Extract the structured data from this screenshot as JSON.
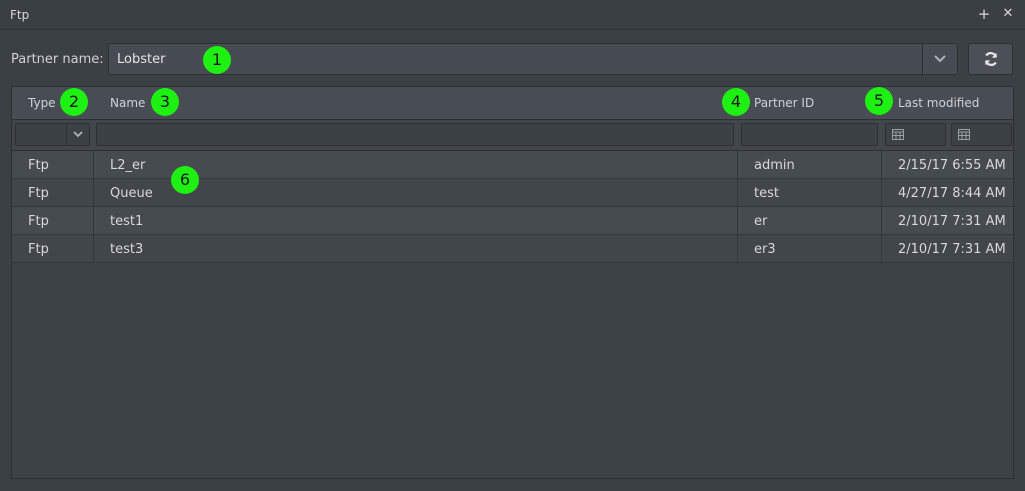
{
  "window": {
    "title": "Ftp",
    "maximize_glyph": "+",
    "close_glyph": "✕"
  },
  "partner": {
    "label": "Partner name:",
    "value": "Lobster"
  },
  "table": {
    "columns": [
      "Type",
      "Name",
      "Partner ID",
      "Last modified"
    ],
    "rows": [
      {
        "type": "Ftp",
        "name": "L2_er",
        "partner_id": "admin",
        "last_modified": "2/15/17 6:55 AM"
      },
      {
        "type": "Ftp",
        "name": "Queue",
        "partner_id": "test",
        "last_modified": "4/27/17 8:44 AM"
      },
      {
        "type": "Ftp",
        "name": "test1",
        "partner_id": "er",
        "last_modified": "2/10/17 7:31 AM"
      },
      {
        "type": "Ftp",
        "name": "test3",
        "partner_id": "er3",
        "last_modified": "2/10/17 7:31 AM"
      }
    ]
  },
  "markers": [
    "1",
    "2",
    "3",
    "4",
    "5",
    "6"
  ],
  "colors": {
    "marker": "#1ef014",
    "background": "#3b4044",
    "row_alt": "#454b4f"
  }
}
